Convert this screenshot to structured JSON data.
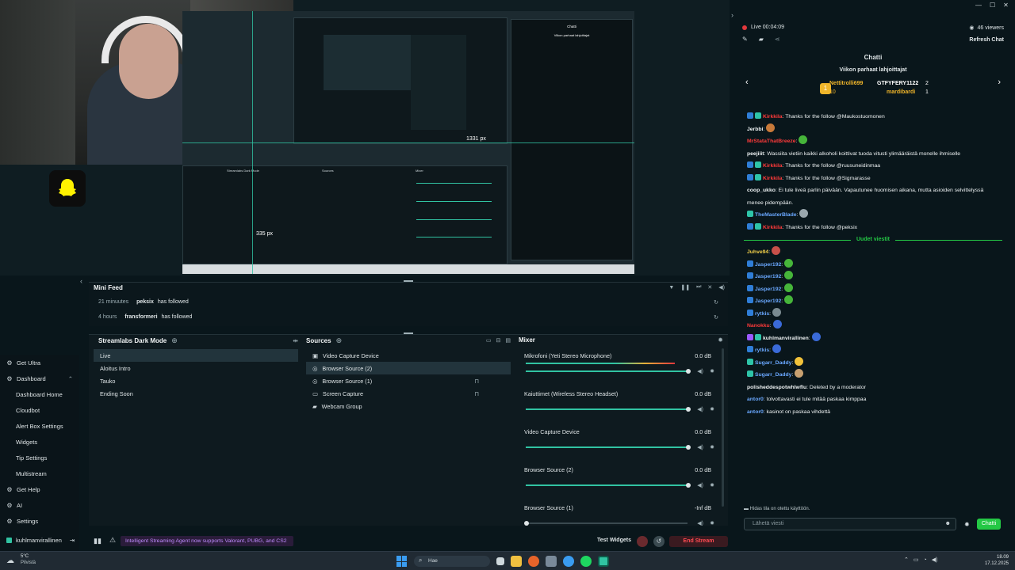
{
  "window": {
    "controls": [
      "—",
      "☐",
      "✕"
    ]
  },
  "preview": {
    "capture_label_width": "1331 px",
    "capture_label_height": "335 px",
    "inner_editor_title": "Streamlabs Dark Mode",
    "inner_sources": "Sources",
    "inner_mixer": "Mixer",
    "inner_chat_title": "Chatti",
    "inner_chat_sub": "Viikon parhaat lahjoittajat"
  },
  "mini_feed": {
    "title": "Mini Feed",
    "events": [
      {
        "time": "21 minuutes",
        "user": "peksix",
        "action": "has followed"
      },
      {
        "time": "4 hours",
        "user": "fransformeri",
        "action": "has followed"
      }
    ]
  },
  "scenes": {
    "title": "Streamlabs Dark Mode",
    "items": [
      "Live",
      "Aloitus Intro",
      "Tauko",
      "Ending Soon"
    ]
  },
  "sources": {
    "title": "Sources",
    "items": [
      {
        "label": "Video Capture Device",
        "icon": "camera-icon"
      },
      {
        "label": "Browser Source (2)",
        "icon": "globe-icon"
      },
      {
        "label": "Browser Source (1)",
        "icon": "globe-icon"
      },
      {
        "label": "Screen Capture",
        "icon": "monitor-icon"
      },
      {
        "label": "Webcam Group",
        "icon": "folder-icon"
      }
    ]
  },
  "mixer": {
    "title": "Mixer",
    "channels": [
      {
        "name": "Mikrofoni (Yeti Stereo Microphone)",
        "db": "0.0 dB"
      },
      {
        "name": "Kaiuttimet (Wireless Stereo Headset)",
        "db": "0.0 dB"
      },
      {
        "name": "Video Capture Device",
        "db": "0.0 dB"
      },
      {
        "name": "Browser Source (2)",
        "db": "0.0 dB"
      },
      {
        "name": "Browser Source (1)",
        "db": "-Inf dB"
      }
    ]
  },
  "left_nav": {
    "items": [
      {
        "label": "Get Ultra",
        "icon": "ultra-icon",
        "sub": false
      },
      {
        "label": "Dashboard",
        "icon": "dashboard-icon",
        "sub": false
      },
      {
        "label": "Dashboard Home",
        "icon": "",
        "sub": true
      },
      {
        "label": "Cloudbot",
        "icon": "",
        "sub": true
      },
      {
        "label": "Alert Box Settings",
        "icon": "",
        "sub": true
      },
      {
        "label": "Widgets",
        "icon": "",
        "sub": true
      },
      {
        "label": "Tip Settings",
        "icon": "",
        "sub": true
      },
      {
        "label": "Multistream",
        "icon": "",
        "sub": true
      },
      {
        "label": "Get Help",
        "icon": "help-icon",
        "sub": false
      },
      {
        "label": "AI",
        "icon": "ai-icon",
        "sub": false
      },
      {
        "label": "Settings",
        "icon": "settings-icon",
        "sub": false
      }
    ],
    "user": "kuhlmanvirallinen"
  },
  "bottom_bar": {
    "banner": "Intelligent Streaming Agent now supports Valorant, PUBG, and CS2",
    "test_widgets": "Test Widgets",
    "end_stream": "End Stream"
  },
  "stream_header": {
    "live": "Live 00:04:09",
    "viewers": "46 viewers",
    "refresh": "Refresh Chat"
  },
  "chat": {
    "title": "Chatti",
    "top_donors_title": "Viikon parhaat lahjoittajat",
    "donors": [
      {
        "name": "Nettitrolli699",
        "amount": "10"
      },
      {
        "name": "GTFYFERY1122",
        "amount": "2"
      },
      {
        "name": "mardibardi",
        "amount": "1"
      }
    ],
    "messages": [
      {
        "user": "Kirkkila",
        "text": ": Thanks for the follow @Maukostuomonen",
        "color": "#ff3a3a",
        "badges": [
          "#2f7ed8",
          "#2ec4a8"
        ],
        "emote": ""
      },
      {
        "user": "Jerbbi",
        "text": ":",
        "color": "#eef2f3",
        "badges": [],
        "emote": "#c87a3a"
      },
      {
        "user": "MrStataThatBreeze",
        "text": ":",
        "color": "#ff3a3a",
        "badges": [],
        "emote": "#46b53a"
      },
      {
        "user": "peejiiit",
        "text": ": Wassiita vietiin kaikki alkoholi koittivat tuoda vitusti ylimääräistä monelle ihmiselle",
        "color": "#eef2f3",
        "badges": [],
        "emote": ""
      },
      {
        "user": "Kirkkila",
        "text": ": Thanks for the follow @ruusuneidinmaa",
        "color": "#ff3a3a",
        "badges": [
          "#2f7ed8",
          "#2ec4a8"
        ],
        "emote": ""
      },
      {
        "user": "Kirkkila",
        "text": ": Thanks for the follow @Sigmarasse",
        "color": "#ff3a3a",
        "badges": [
          "#2f7ed8",
          "#2ec4a8"
        ],
        "emote": ""
      },
      {
        "user": "coop_ukko",
        "text": ": Ei tule liveä parlin päivään. Vapautunee huomisen aikana, mutta asioiden selvittelyssä",
        "color": "#eef2f3",
        "badges": [],
        "emote": ""
      },
      {
        "user": "",
        "text": "menee pidempään.",
        "color": "#eef2f3",
        "badges": [],
        "emote": ""
      },
      {
        "user": "TheMasterBlade",
        "text": ":",
        "color": "#6aa8ff",
        "badges": [
          "#2ec4a8"
        ],
        "emote": "#9aa7ad"
      },
      {
        "user": "Kirkkila",
        "text": ": Thanks for the follow @peksix",
        "color": "#ff3a3a",
        "badges": [
          "#2f7ed8",
          "#2ec4a8"
        ],
        "emote": ""
      }
    ],
    "divider": "Uudet viestit",
    "new_messages": [
      {
        "user": "Juhve94",
        "text": ":",
        "color": "#f2d04a",
        "badges": [],
        "emote": "#c8504a"
      },
      {
        "user": "Jasper192",
        "text": ":",
        "color": "#6aa8ff",
        "badges": [
          "#2f7ed8"
        ],
        "emote": "#46b53a"
      },
      {
        "user": "Jasper192",
        "text": ":",
        "color": "#6aa8ff",
        "badges": [
          "#2f7ed8"
        ],
        "emote": "#46b53a"
      },
      {
        "user": "Jasper192",
        "text": ":",
        "color": "#6aa8ff",
        "badges": [
          "#2f7ed8"
        ],
        "emote": "#46b53a"
      },
      {
        "user": "Jasper192",
        "text": ":",
        "color": "#6aa8ff",
        "badges": [
          "#2f7ed8"
        ],
        "emote": "#46b53a"
      },
      {
        "user": "rytkis",
        "text": ":",
        "color": "#6aa8ff",
        "badges": [
          "#2f7ed8"
        ],
        "emote": "#7a8a90"
      },
      {
        "user": "Nanokku",
        "text": ":",
        "color": "#ff3a3a",
        "badges": [],
        "emote": "#3a6ad8"
      },
      {
        "user": "kuhlmanvirallinen",
        "text": ":",
        "color": "#eef2f3",
        "badges": [
          "#9b59ff",
          "#2ec4a8"
        ],
        "emote": "#3a6ad8"
      },
      {
        "user": "rytkis",
        "text": ":",
        "color": "#6aa8ff",
        "badges": [
          "#2f7ed8"
        ],
        "emote": "#3a6ad8"
      },
      {
        "user": "Sugarr_Daddy",
        "text": ":",
        "color": "#6aa8ff",
        "badges": [
          "#2ec4a8"
        ],
        "emote": "#f2c23a"
      },
      {
        "user": "Sugarr_Daddy",
        "text": ":",
        "color": "#6aa8ff",
        "badges": [
          "#2ec4a8"
        ],
        "emote": "#c8a070"
      },
      {
        "user": "polisheddespotwhlwflu",
        "text": ": Deleted by a moderator",
        "color": "#eef2f3",
        "badges": [],
        "emote": ""
      },
      {
        "user": "antor0",
        "text": ": tolvottavasti ei tule mitää paskaa kimppaa",
        "color": "#6aa8ff",
        "badges": [],
        "emote": ""
      },
      {
        "user": "antor0",
        "text": ": kasinot on paskaa vihdettä",
        "color": "#6aa8ff",
        "badges": [],
        "emote": ""
      }
    ],
    "notice": "Hidas tila on otettu käyttöön.",
    "input_placeholder": "Lähetä viesti",
    "send_label": "Chatti"
  },
  "taskbar": {
    "weather_temp": "5°C",
    "weather_desc": "Pilvistä",
    "search_placeholder": "Hae",
    "time": "18.09",
    "date": "17.12.2025"
  },
  "colors": {
    "accent": "#31c3a2",
    "live_red": "#e2383c",
    "chat_green": "#24c845"
  }
}
